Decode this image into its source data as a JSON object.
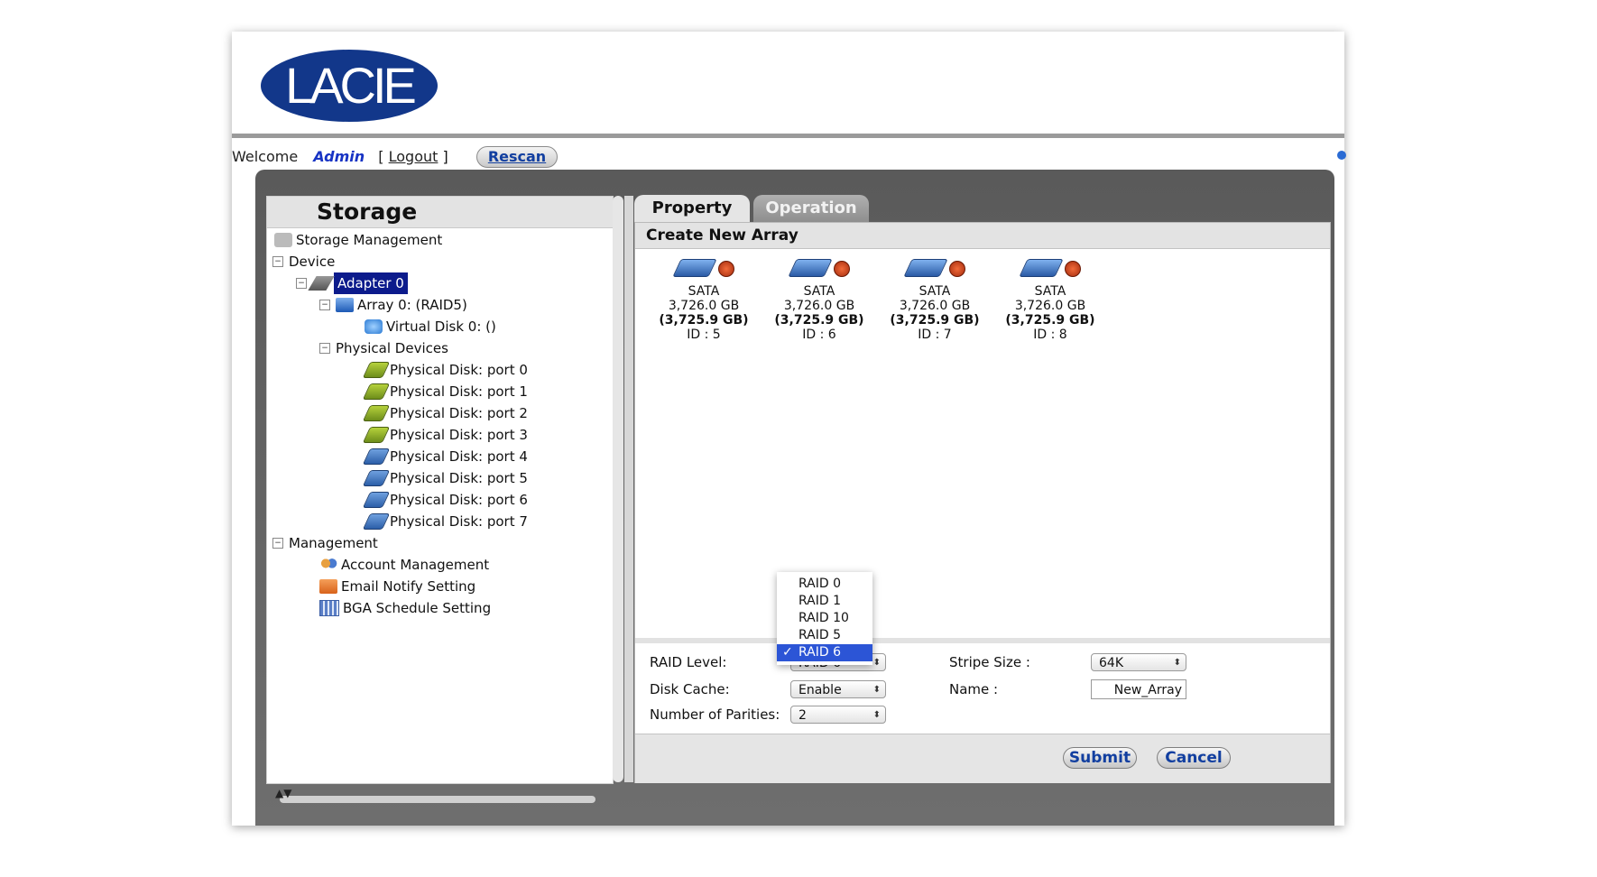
{
  "header": {
    "logo_text": "LACIE"
  },
  "welcome": {
    "text": "Welcome",
    "user": "Admin",
    "bracket_open": "[",
    "logout": "Logout",
    "bracket_close": "]",
    "rescan": "Rescan"
  },
  "left": {
    "title": "Storage",
    "storage_management": "Storage Management",
    "device": "Device",
    "adapter": "Adapter 0",
    "array": "Array 0: (RAID5)",
    "virtual_disk": "Virtual Disk 0: ()",
    "physical_devices": "Physical Devices",
    "disks": [
      "Physical Disk: port 0",
      "Physical Disk: port 1",
      "Physical Disk: port 2",
      "Physical Disk: port 3",
      "Physical Disk: port 4",
      "Physical Disk: port 5",
      "Physical Disk: port 6",
      "Physical Disk: port 7"
    ],
    "management": "Management",
    "account": "Account Management",
    "email": "Email Notify Setting",
    "bga": "BGA Schedule Setting",
    "nav_arrows": "▲▼"
  },
  "tabs": {
    "property": "Property",
    "operation": "Operation"
  },
  "right": {
    "title": "Create New Array",
    "disk_cards": [
      {
        "type": "SATA",
        "size": "3,726.0 GB",
        "size_bold": "(3,725.9 GB)",
        "id": "ID : 5"
      },
      {
        "type": "SATA",
        "size": "3,726.0 GB",
        "size_bold": "(3,725.9 GB)",
        "id": "ID : 6"
      },
      {
        "type": "SATA",
        "size": "3,726.0 GB",
        "size_bold": "(3,725.9 GB)",
        "id": "ID : 7"
      },
      {
        "type": "SATA",
        "size": "3,726.0 GB",
        "size_bold": "(3,725.9 GB)",
        "id": "ID : 8"
      }
    ]
  },
  "form": {
    "raid_level_label": "RAID Level:",
    "raid_level_value": "RAID 6",
    "raid_options": [
      "RAID 0",
      "RAID 1",
      "RAID 10",
      "RAID 5",
      "RAID 6"
    ],
    "check_mark": "✓",
    "disk_cache_label": "Disk Cache:",
    "disk_cache_value": "Enable",
    "parities_label": "Number of Parities:",
    "parities_value": "2",
    "stripe_label": "Stripe Size :",
    "stripe_value": "64K",
    "name_label": "Name :",
    "name_value": "New_Array"
  },
  "buttons": {
    "submit": "Submit",
    "cancel": "Cancel"
  }
}
